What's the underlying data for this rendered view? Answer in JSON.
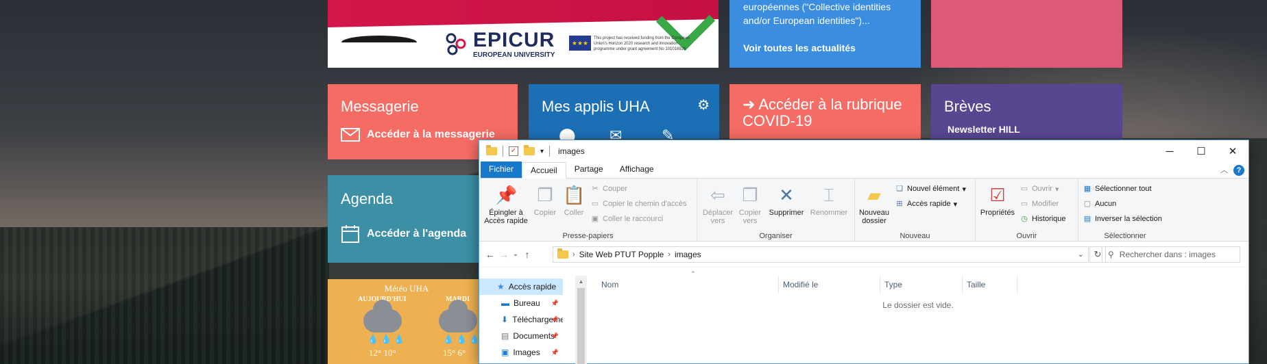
{
  "banner": {
    "logo_text": "EPICUR",
    "logo_sub": "EUROPEAN UNIVERSITY",
    "eu_text": "This project has received funding from the European Union's Horizon 2020 research and innovation programme under grant agreement No 101016926"
  },
  "news": {
    "text": "européennes (\"Collective identities and/or European identities\")...",
    "link": "Voir toutes les actualités"
  },
  "tiles": {
    "messagerie": {
      "title": "Messagerie",
      "action": "Accéder à la messagerie"
    },
    "applis": {
      "title": "Mes applis UHA"
    },
    "covid": {
      "title": "Accéder à la rubrique COVID-19"
    },
    "breves": {
      "title": "Brèves",
      "sub": "Newsletter HILL"
    },
    "agenda": {
      "title": "Agenda",
      "action": "Accéder à l'agenda"
    }
  },
  "meteo": {
    "title": "Météo UHA",
    "days": [
      {
        "label": "AUJOURD'HUI",
        "temp_max": "12°",
        "temp_min": "10°"
      },
      {
        "label": "MARDI",
        "temp_max": "15°",
        "temp_min": "6°"
      }
    ]
  },
  "explorer": {
    "title": "images",
    "tabs": [
      "Fichier",
      "Accueil",
      "Partage",
      "Affichage"
    ],
    "ribbon": {
      "presse": {
        "name": "Presse-papiers",
        "pin": "Épingler à Accès rapide",
        "copy": "Copier",
        "paste": "Coller",
        "cut": "Couper",
        "copy_path": "Copier le chemin d'accès",
        "paste_shortcut": "Coller le raccourci"
      },
      "organiser": {
        "name": "Organiser",
        "move": "Déplacer vers",
        "copyto": "Copier vers",
        "delete": "Supprimer",
        "rename": "Renommer"
      },
      "nouveau": {
        "name": "Nouveau",
        "new_folder": "Nouveau dossier",
        "new_item": "Nouvel élément",
        "easy_access": "Accès rapide"
      },
      "ouvrir": {
        "name": "Ouvrir",
        "properties": "Propriétés",
        "open": "Ouvrir",
        "edit": "Modifier",
        "history": "Historique"
      },
      "selectionner": {
        "name": "Sélectionner",
        "select_all": "Sélectionner tout",
        "select_none": "Aucun",
        "invert": "Inverser la sélection"
      }
    },
    "address": {
      "crumbs": [
        "Site Web PTUT Popple",
        "images"
      ]
    },
    "search_placeholder": "Rechercher dans : images",
    "nav": [
      {
        "label": "Accès rapide",
        "icon": "star-icon"
      },
      {
        "label": "Bureau",
        "icon": "desktop-icon",
        "pinned": true
      },
      {
        "label": "Téléchargements",
        "icon": "download-icon",
        "pinned": true
      },
      {
        "label": "Documents",
        "icon": "documents-icon",
        "pinned": true
      },
      {
        "label": "Images",
        "icon": "images-icon",
        "pinned": true
      }
    ],
    "columns": [
      "Nom",
      "Modifié le",
      "Type",
      "Taille"
    ],
    "empty_message": "Le dossier est vide."
  },
  "colors": {
    "messagerie": "#f56c64",
    "applis": "#1d6fb5",
    "covid": "#f56c64",
    "breves": "#594691",
    "agenda": "#3d8fa5",
    "meteo": "#eeb051",
    "news": "#3b8de0",
    "accent": "#1979ca"
  }
}
